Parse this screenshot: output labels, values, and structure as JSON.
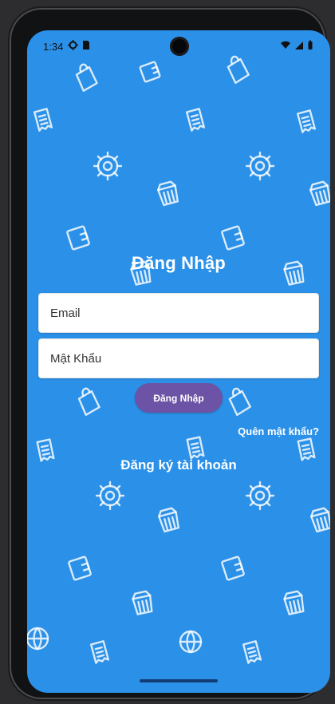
{
  "status_bar": {
    "time": "1:34",
    "left_icons": [
      "settings-icon",
      "sim-card-icon"
    ],
    "right_icons": [
      "wifi-icon",
      "cellular-signal-icon",
      "battery-icon"
    ]
  },
  "login": {
    "title": "Đăng Nhập",
    "email_placeholder": "Email",
    "password_placeholder": "Mật Khẩu",
    "login_button": "Đăng Nhập",
    "forgot_password": "Quên mật khẩu?",
    "register": "Đăng ký tài khoản"
  },
  "theme": {
    "background": "#2b90e8",
    "button": "#6c53a5",
    "text": "#ffffff",
    "field": "#ffffff"
  },
  "background_icons": [
    "shopping-bag-icon",
    "wallet-icon",
    "store-icon",
    "gear-icon",
    "globe-icon",
    "receipt-icon"
  ]
}
